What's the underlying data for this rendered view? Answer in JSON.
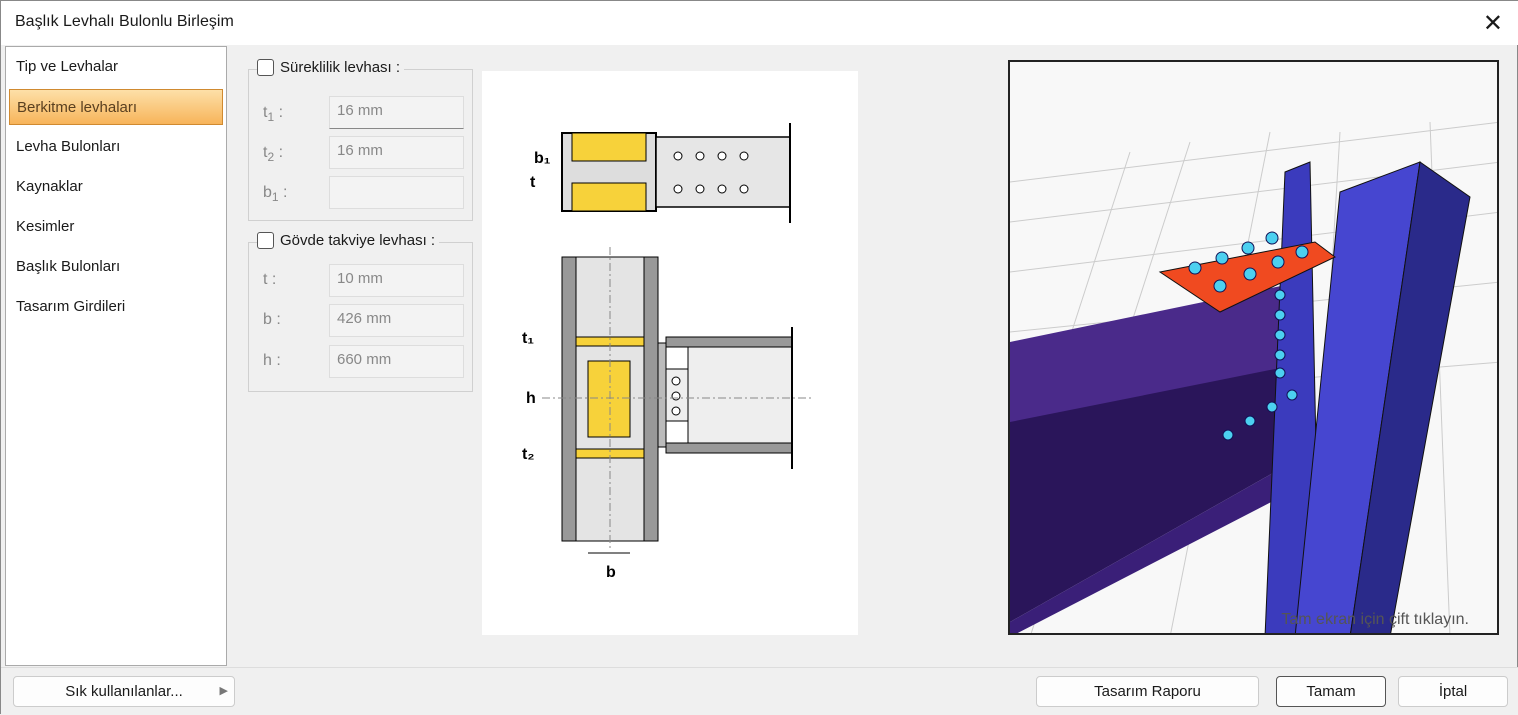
{
  "window": {
    "title": "Başlık Levhalı Bulonlu Birleşim",
    "close_icon": "close-icon"
  },
  "sidebar": {
    "items": [
      {
        "label": "Tip ve Levhalar"
      },
      {
        "label": "Berkitme levhaları"
      },
      {
        "label": "Levha Bulonları"
      },
      {
        "label": "Kaynaklar"
      },
      {
        "label": "Kesimler"
      },
      {
        "label": "Başlık Bulonları"
      },
      {
        "label": "Tasarım Girdileri"
      }
    ],
    "active_index": 1
  },
  "continuity": {
    "title": "Süreklilik levhası :",
    "checked": false,
    "t1_label": "t",
    "t1_sub": "1",
    "t1_value": "16 mm",
    "t2_label": "t",
    "t2_sub": "2",
    "t2_value": "16 mm",
    "b1_label": "b",
    "b1_sub": "1",
    "b1_value": ""
  },
  "web": {
    "title": "Gövde takviye levhası :",
    "checked": false,
    "t_label": "t",
    "t_value": "10 mm",
    "b_label": "b",
    "b_value": "426 mm",
    "h_label": "h",
    "h_value": "660 mm"
  },
  "drawing": {
    "b1": "b₁",
    "t": "t",
    "t1": "t₁",
    "h": "h",
    "t2": "t₂",
    "b": "b"
  },
  "view3d": {
    "hint": "Tam ekran için çift tıklayın."
  },
  "footer": {
    "favorites": "Sık kullanılanlar...",
    "report": "Tasarım Raporu",
    "ok": "Tamam",
    "cancel": "İptal"
  }
}
